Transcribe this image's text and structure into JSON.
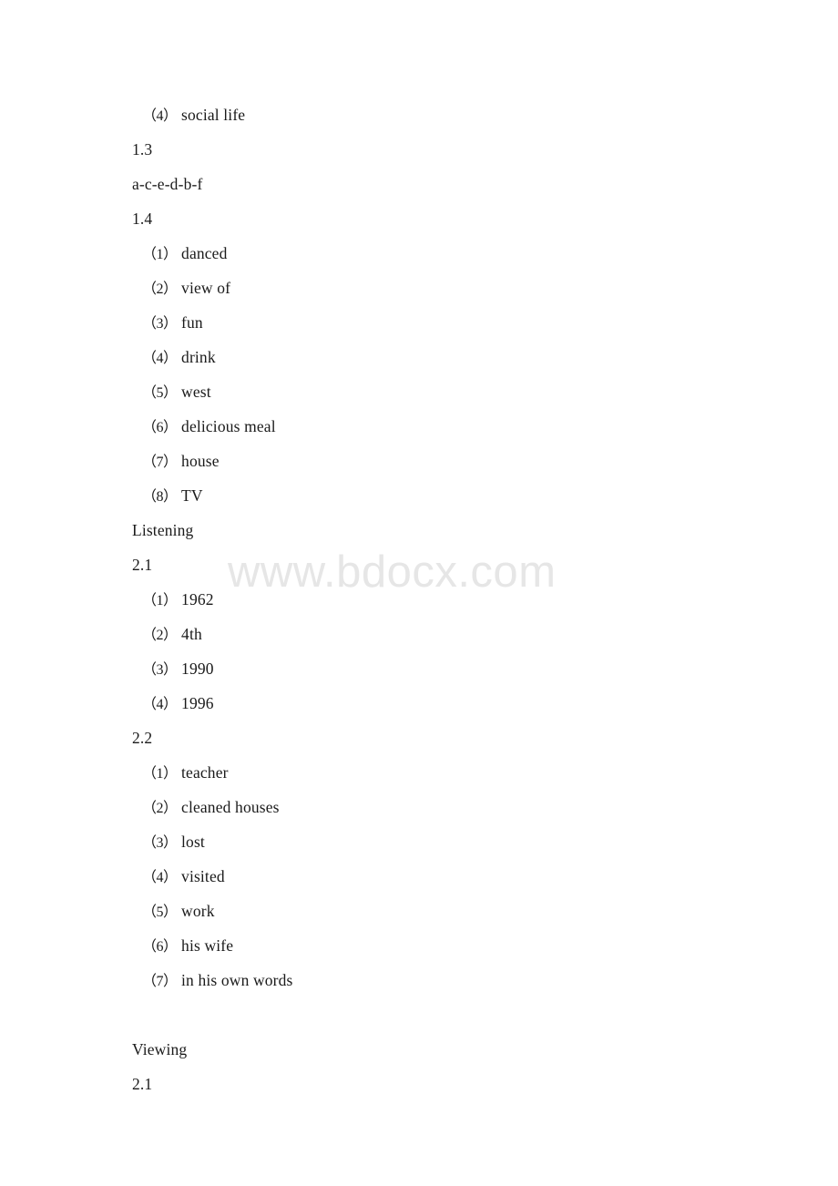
{
  "document": {
    "watermark": "www.bdocx.com",
    "watermark_color": "#e6e6e6",
    "text_color": "#1a1a1a",
    "background_color": "#ffffff",
    "lines": [
      {
        "marker": "（4）",
        "text": "social life",
        "indent": 1
      },
      {
        "marker": "",
        "text": "1.3",
        "indent": 0
      },
      {
        "marker": "",
        "text": "a-c-e-d-b-f",
        "indent": 0
      },
      {
        "marker": "",
        "text": "1.4",
        "indent": 0
      },
      {
        "marker": "（1）",
        "text": "danced",
        "indent": 1
      },
      {
        "marker": "（2）",
        "text": "view of",
        "indent": 1
      },
      {
        "marker": "（3）",
        "text": "fun",
        "indent": 1
      },
      {
        "marker": "（4）",
        "text": "drink",
        "indent": 1
      },
      {
        "marker": "（5）",
        "text": "west",
        "indent": 1
      },
      {
        "marker": "（6）",
        "text": "delicious meal",
        "indent": 1
      },
      {
        "marker": "（7）",
        "text": "house",
        "indent": 1
      },
      {
        "marker": "（8）",
        "text": "TV",
        "indent": 1
      },
      {
        "marker": "",
        "text": "Listening",
        "indent": 0
      },
      {
        "marker": "",
        "text": "2.1",
        "indent": 0
      },
      {
        "marker": "（1）",
        "text": "1962",
        "indent": 1
      },
      {
        "marker": "（2）",
        "text": "4th",
        "indent": 1
      },
      {
        "marker": "（3）",
        "text": "1990",
        "indent": 1
      },
      {
        "marker": "（4）",
        "text": "1996",
        "indent": 1
      },
      {
        "marker": "",
        "text": "2.2",
        "indent": 0
      },
      {
        "marker": "（1）",
        "text": "teacher",
        "indent": 1
      },
      {
        "marker": "（2）",
        "text": "cleaned houses",
        "indent": 1
      },
      {
        "marker": "（3）",
        "text": "lost",
        "indent": 1
      },
      {
        "marker": "（4）",
        "text": "visited",
        "indent": 1
      },
      {
        "marker": "（5）",
        "text": "work",
        "indent": 1
      },
      {
        "marker": "（6）",
        "text": "his wife",
        "indent": 1
      },
      {
        "marker": "（7）",
        "text": "in his own words",
        "indent": 1
      },
      {
        "marker": "",
        "text": "",
        "indent": 0
      },
      {
        "marker": "",
        "text": "Viewing",
        "indent": 0
      },
      {
        "marker": "",
        "text": "2.1",
        "indent": 0
      }
    ]
  }
}
